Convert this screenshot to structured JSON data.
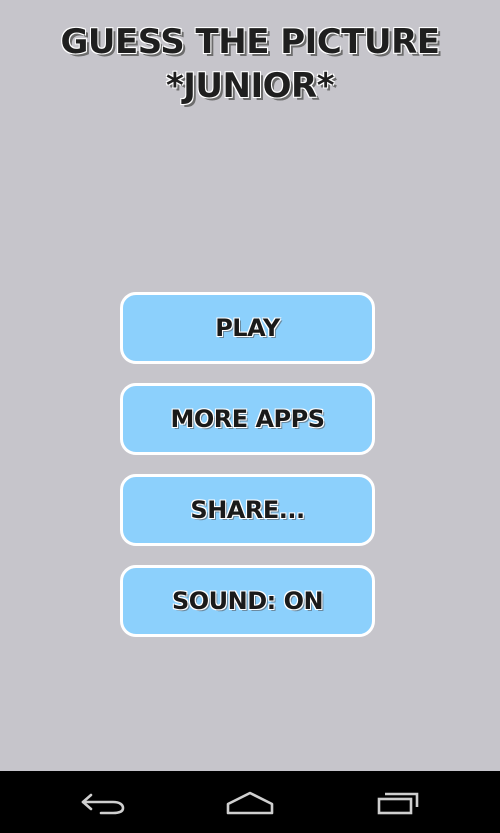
{
  "title": {
    "line1": "GUESS THE PICTURE",
    "line2": "*JUNIOR*"
  },
  "menu": {
    "play": "PLAY",
    "more_apps": "MORE APPS",
    "share": "SHARE...",
    "sound": "SOUND: ON"
  },
  "navbar": {
    "icons": [
      "back-icon",
      "home-icon",
      "recent-apps-icon"
    ]
  },
  "colors": {
    "background": "#c6c5cb",
    "button_fill": "#8cd0fc",
    "button_border": "#ffffff",
    "navbar": "#000000"
  }
}
